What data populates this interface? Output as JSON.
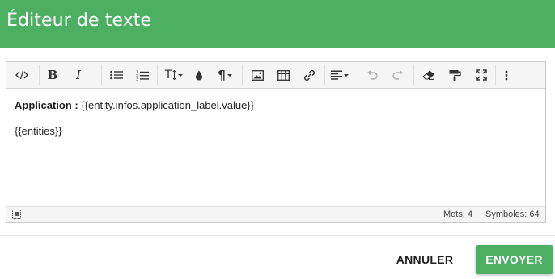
{
  "dialog": {
    "title": "Éditeur de texte",
    "accent_color": "#4caf62"
  },
  "toolbar": {
    "buttons": [
      {
        "name": "code-view-icon"
      },
      {
        "name": "bold-icon",
        "label": "B"
      },
      {
        "name": "italic-icon",
        "label": "I"
      },
      {
        "name": "unordered-list-icon"
      },
      {
        "name": "ordered-list-icon"
      },
      {
        "name": "font-size-icon",
        "label": "T"
      },
      {
        "name": "text-color-icon"
      },
      {
        "name": "paragraph-icon",
        "label": "¶"
      },
      {
        "name": "image-icon"
      },
      {
        "name": "table-icon"
      },
      {
        "name": "link-icon"
      },
      {
        "name": "align-icon"
      },
      {
        "name": "undo-icon",
        "disabled": true
      },
      {
        "name": "redo-icon",
        "disabled": true
      },
      {
        "name": "eraser-icon"
      },
      {
        "name": "format-painter-icon"
      },
      {
        "name": "fullscreen-icon"
      },
      {
        "name": "more-icon"
      }
    ]
  },
  "content": {
    "line1_label": "Application :",
    "line1_value": "{{entity.infos.application_label.value}}",
    "line2": "{{entities}}"
  },
  "status": {
    "words": "Mots: 4",
    "symbols": "Symboles: 64"
  },
  "actions": {
    "cancel_label": "ANNULER",
    "submit_label": "ENVOYER"
  }
}
